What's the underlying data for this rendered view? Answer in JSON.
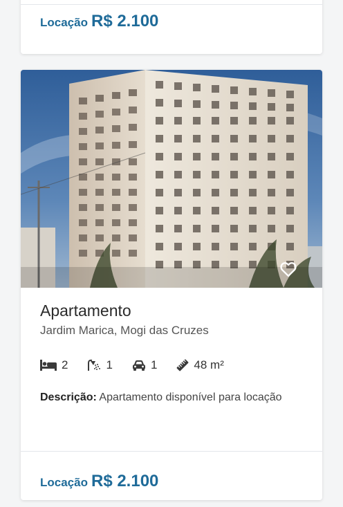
{
  "listing_prev": {
    "price_label": "Locação",
    "price_value": "R$ 2.100"
  },
  "listing": {
    "title": "Apartamento",
    "address": "Jardim Marica, Mogi das Cruzes",
    "features": {
      "bedrooms": "2",
      "bathrooms": "1",
      "parking": "1",
      "area": "48 m²"
    },
    "description_label": "Descrição:",
    "description_text": "Apartamento disponível para locação",
    "price_label": "Locação",
    "price_value": "R$ 2.100",
    "icons": [
      "heart-outline-icon",
      "bed-icon",
      "shower-icon",
      "car-icon",
      "ruler-icon"
    ]
  },
  "colors": {
    "accent": "#1f6b99",
    "sky": "#4a78a8",
    "building": "#e3dccf"
  }
}
